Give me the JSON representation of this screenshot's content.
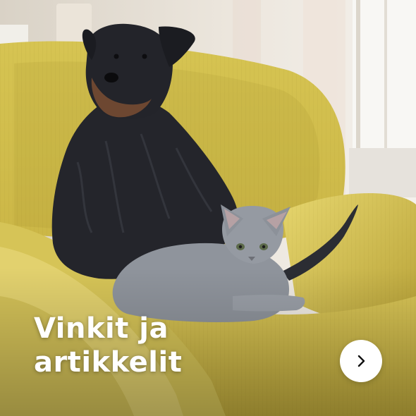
{
  "card": {
    "title_line_1": "Vinkit ja",
    "title_line_2": "artikkelit",
    "next_button": {
      "icon": "chevron-right-icon",
      "icon_color": "#111111",
      "background": "#ffffff"
    }
  },
  "colors": {
    "chair": "#d8c655",
    "dog": "#22232a",
    "cat": "#8f949c",
    "background": "#e9e4dc"
  }
}
